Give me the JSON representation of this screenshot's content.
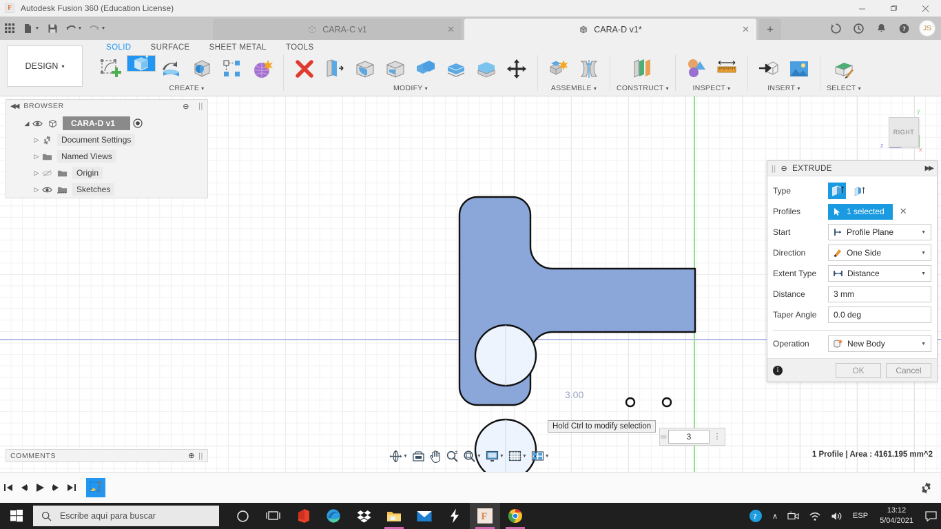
{
  "window": {
    "title": "Autodesk Fusion 360 (Education License)",
    "minimize": "—",
    "maximize": "❐",
    "close": "✕"
  },
  "quick_access": {
    "grid_icon": "grid-apps-icon",
    "new_icon": "new-document-icon",
    "save_icon": "save-icon",
    "undo_icon": "undo-icon",
    "redo_icon": "redo-icon"
  },
  "tabs": [
    {
      "label": "CARA-C v1",
      "active": false,
      "close": "✕"
    },
    {
      "label": "CARA-D v1*",
      "active": true,
      "close": "✕"
    }
  ],
  "tab_add": "+",
  "account": {
    "initials": "JS",
    "help_icon": "help-icon",
    "bell_icon": "notification-bell-icon",
    "clock_icon": "recent-activity-icon",
    "refresh_icon": "job-status-icon"
  },
  "design_menu": {
    "label": "DESIGN",
    "caret": "▾"
  },
  "workspace_tabs": [
    {
      "label": "SOLID",
      "active": true
    },
    {
      "label": "SURFACE",
      "active": false
    },
    {
      "label": "SHEET METAL",
      "active": false
    },
    {
      "label": "TOOLS",
      "active": false
    }
  ],
  "ribbon_panels": [
    {
      "label": "CREATE",
      "caret": "▾",
      "tools": [
        "new-sketch-icon",
        "extrude-icon",
        "revolve-icon",
        "sweep-icon",
        "pattern-icon",
        "create-form-icon"
      ]
    },
    {
      "label": "MODIFY",
      "caret": "▾",
      "tools": [
        "press-pull-icon",
        "fillet-icon",
        "shell-icon",
        "draft-icon",
        "combine-icon",
        "offset-face-icon",
        "split-body-icon",
        "move-copy-icon"
      ]
    },
    {
      "label": "ASSEMBLE",
      "caret": "▾",
      "tools": [
        "new-component-icon",
        "joint-icon"
      ]
    },
    {
      "label": "CONSTRUCT",
      "caret": "▾",
      "tools": [
        "offset-plane-icon"
      ]
    },
    {
      "label": "INSPECT",
      "caret": "▾",
      "tools": [
        "interference-icon",
        "measure-icon"
      ]
    },
    {
      "label": "INSERT",
      "caret": "▾",
      "tools": [
        "insert-derive-icon",
        "decal-icon"
      ]
    },
    {
      "label": "SELECT",
      "caret": "▾",
      "tools": [
        "select-icon"
      ]
    }
  ],
  "browser": {
    "title": "BROWSER",
    "collapse_icon": "collapse-left-icon",
    "minimize_icon": "minimize-panel-icon",
    "nodes": [
      {
        "label": "CARA-D v1",
        "level": "root",
        "twisty": "◢",
        "eye": "visible-eye-icon"
      },
      {
        "label": "Document Settings",
        "level": "child",
        "twisty": "▷",
        "icon": "gear-icon"
      },
      {
        "label": "Named Views",
        "level": "child",
        "twisty": "▷",
        "icon": "folder-icon"
      },
      {
        "label": "Origin",
        "level": "child",
        "twisty": "▷",
        "icon": "folder-icon",
        "eye": "hidden-eye-icon"
      },
      {
        "label": "Sketches",
        "level": "child",
        "twisty": "▷",
        "icon": "sketch-folder-icon",
        "eye": "visible-eye-icon"
      }
    ]
  },
  "canvas": {
    "dimension_label": "3.00",
    "tooltip": "Hold Ctrl to modify selection",
    "manipulator_value": "3",
    "viewcube_face": "RIGHT",
    "axis_labels": {
      "x": "x",
      "y": "y",
      "z": "z"
    },
    "body_color": "#8BA6D9",
    "hole_color": "#EDF4FD",
    "green_axis": "#8ce08c",
    "blue_axis": "#b7bbe8"
  },
  "navbar": {
    "tools": [
      "orbit-icon",
      "pan-extents-icon",
      "pan-icon",
      "zoom-icon",
      "zoom-window-icon",
      "display-settings-icon",
      "grid-snaps-icon",
      "viewports-icon"
    ],
    "caret": "▾"
  },
  "status": {
    "text": "1 Profile | Area : 4161.195 mm^2"
  },
  "comments": {
    "title": "COMMENTS",
    "add_icon": "add-comment-icon"
  },
  "timeline": {
    "buttons": [
      "go-to-beginning-icon",
      "step-back-icon",
      "play-icon",
      "step-forward-icon",
      "go-to-end-icon"
    ],
    "feature": "sketch-feature-icon",
    "settings_icon": "settings-gear-icon"
  },
  "extrude_dialog": {
    "title": "EXTRUDE",
    "minimize_icon": "minimize-dialog-icon",
    "expand_icon": "expand-dialog-icon",
    "rows": {
      "type_label": "Type",
      "type_options": [
        "solid-extrude-icon",
        "thin-extrude-icon"
      ],
      "profiles_label": "Profiles",
      "profiles_value": "1 selected",
      "profiles_clear": "✕",
      "start_label": "Start",
      "start_value": "Profile Plane",
      "direction_label": "Direction",
      "direction_value": "One Side",
      "extent_label": "Extent Type",
      "extent_value": "Distance",
      "distance_label": "Distance",
      "distance_value": "3 mm",
      "taper_label": "Taper Angle",
      "taper_value": "0.0 deg",
      "operation_label": "Operation",
      "operation_value": "New Body"
    },
    "ok_label": "OK",
    "cancel_label": "Cancel",
    "info_icon": "info-icon",
    "accent": "#1a9ae1"
  },
  "taskbar": {
    "start_icon": "windows-start-icon",
    "search_placeholder": "Escribe aquí para buscar",
    "search_icon": "search-icon",
    "apps": [
      "cortana-icon",
      "task-view-icon",
      "office-icon",
      "edge-icon",
      "dropbox-icon",
      "file-explorer-icon",
      "mail-icon",
      "shareit-icon",
      "fusion360-icon",
      "chrome-icon"
    ],
    "tray": {
      "help_icon": "get-help-icon",
      "chevron": "∧",
      "camera_icon": "camera-icon",
      "wifi_icon": "wifi-icon",
      "volume_icon": "volume-icon",
      "language": "ESP",
      "time": "13:12",
      "date": "5/04/2021",
      "action_center_icon": "action-center-icon"
    }
  }
}
